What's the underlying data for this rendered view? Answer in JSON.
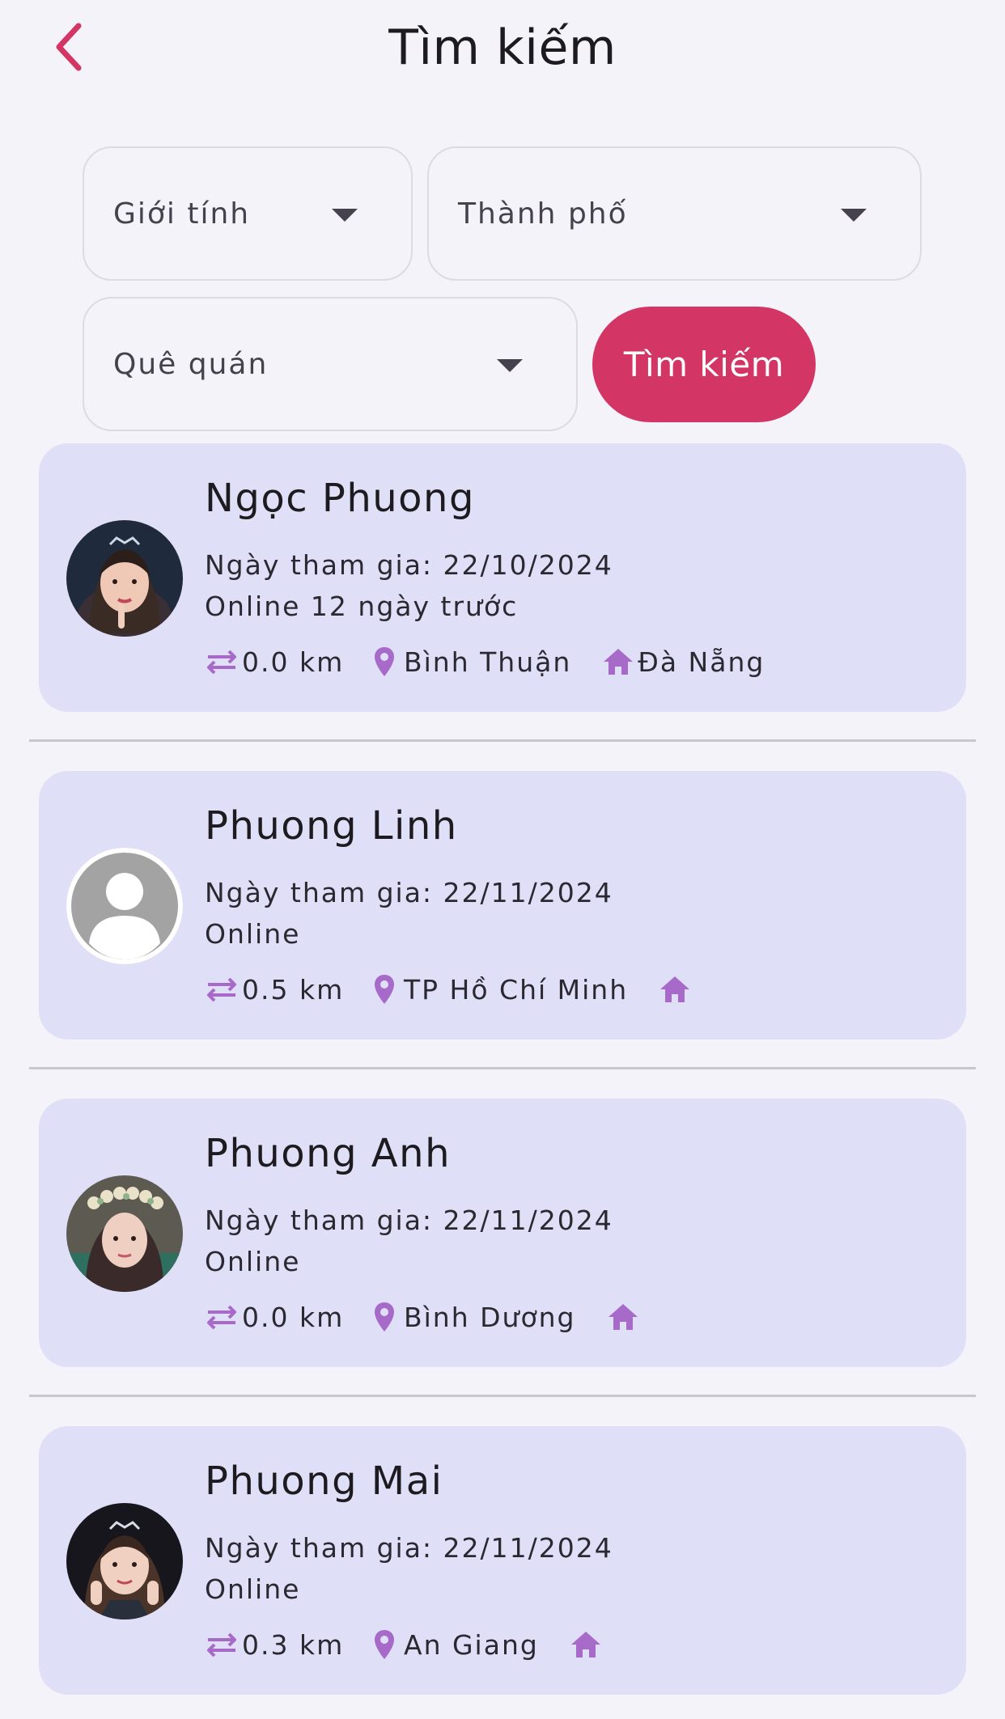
{
  "header": {
    "title": "Tìm kiếm",
    "back_icon": "chevron-left-icon"
  },
  "filters": {
    "gender_placeholder": "Giới tính",
    "city_placeholder": "Thành phố",
    "hometown_placeholder": "Quê quán",
    "search_label": "Tìm kiếm"
  },
  "colors": {
    "accent": "#d33565",
    "card_bg": "#dfe0f8",
    "icon": "#a86ac8",
    "page_bg": "#f4f3f9"
  },
  "results": [
    {
      "name": "Ngọc Phuong",
      "joined": "Ngày tham gia: 22/10/2024",
      "status": "Online 12 ngày trước",
      "distance": "0.0 km",
      "city": "Bình Thuận",
      "hometown": "Đà Nẵng",
      "avatar": "photo"
    },
    {
      "name": "Phuong Linh",
      "joined": "Ngày tham gia: 22/11/2024",
      "status": "Online",
      "distance": "0.5 km",
      "city": "TP Hồ Chí Minh",
      "hometown": "",
      "avatar": "default-person-icon"
    },
    {
      "name": "Phuong Anh",
      "joined": "Ngày tham gia: 22/11/2024",
      "status": "Online",
      "distance": "0.0 km",
      "city": "Bình Dương",
      "hometown": "",
      "avatar": "photo"
    },
    {
      "name": "Phuong Mai",
      "joined": "Ngày tham gia: 22/11/2024",
      "status": "Online",
      "distance": "0.3 km",
      "city": "An Giang",
      "hometown": "",
      "avatar": "photo"
    }
  ]
}
